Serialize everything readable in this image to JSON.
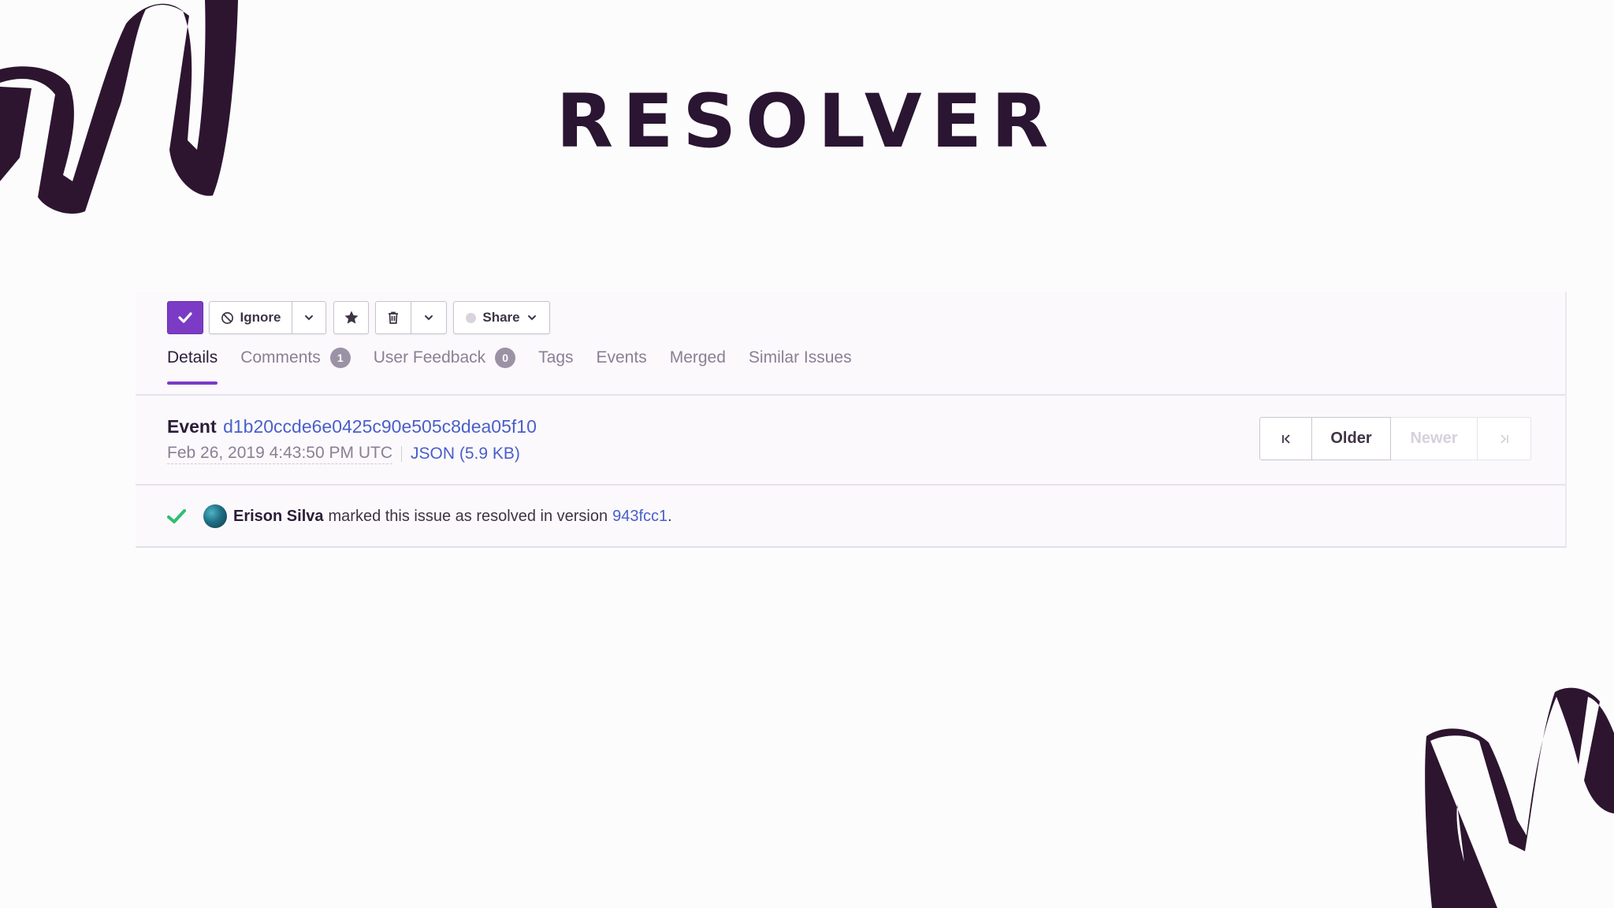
{
  "slide": {
    "title": "RESOLVER"
  },
  "colors": {
    "accent": "#7c3bc5",
    "link": "#4a5fc8",
    "brush": "#2d1530",
    "success": "#2fbf71"
  },
  "toolbar": {
    "resolve_icon": "check-icon",
    "ignore_label": "Ignore",
    "ignore_icon": "no-entry-icon",
    "star_icon": "star-icon",
    "delete_icon": "trash-icon",
    "share_label": "Share"
  },
  "tabs": [
    {
      "label": "Details",
      "active": true
    },
    {
      "label": "Comments",
      "badge": "1"
    },
    {
      "label": "User Feedback",
      "badge": "0"
    },
    {
      "label": "Tags"
    },
    {
      "label": "Events"
    },
    {
      "label": "Merged"
    },
    {
      "label": "Similar Issues"
    }
  ],
  "event": {
    "label": "Event",
    "id": "d1b20ccde6e0425c90e505c8dea05f10",
    "date": "Feb 26, 2019 4:43:50 PM UTC",
    "json_link": "JSON (5.9 KB)"
  },
  "pager": {
    "oldest_icon": "first-page-icon",
    "older_label": "Older",
    "newer_label": "Newer",
    "newest_icon": "last-page-icon"
  },
  "activity": {
    "user": "Erison Silva",
    "text": "marked this issue as resolved in version",
    "version": "943fcc1",
    "end": "."
  }
}
